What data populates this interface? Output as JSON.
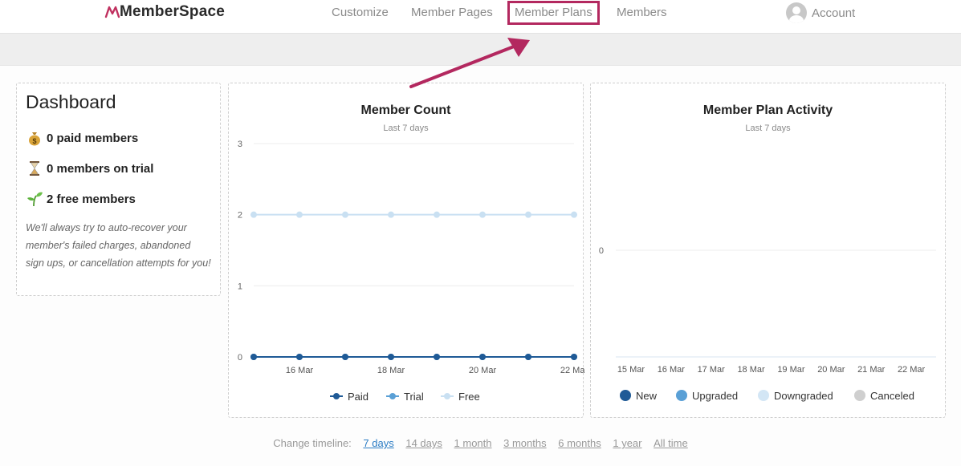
{
  "nav": {
    "logo": "MemberSpace",
    "links": [
      "Customize",
      "Member Pages",
      "Member Plans",
      "Members"
    ],
    "account": "Account"
  },
  "dashboard": {
    "title": "Dashboard",
    "paid": "0 paid members",
    "trial": "0 members on trial",
    "free": "2 free members",
    "note": "We'll always try to auto-recover your member's failed charges, abandoned sign ups, or cancellation attempts for you!"
  },
  "chart_data": [
    {
      "type": "line",
      "title": "Member Count",
      "subtitle": "Last 7 days",
      "x": [
        "15 Mar",
        "16 Mar",
        "17 Mar",
        "18 Mar",
        "19 Mar",
        "20 Mar",
        "21 Mar",
        "22 Mar"
      ],
      "tick_labels": [
        "16 Mar",
        "18 Mar",
        "20 Mar",
        "22 Mar"
      ],
      "yticks": [
        0,
        1,
        2,
        3
      ],
      "ylim": [
        0,
        3
      ],
      "grid": true,
      "legend": "bottom",
      "series": [
        {
          "name": "Paid",
          "values": [
            0,
            0,
            0,
            0,
            0,
            0,
            0,
            0
          ],
          "color": "#1f5a96"
        },
        {
          "name": "Trial",
          "values": [
            0,
            0,
            0,
            0,
            0,
            0,
            0,
            0
          ],
          "color": "#5aa0d6"
        },
        {
          "name": "Free",
          "values": [
            2,
            2,
            2,
            2,
            2,
            2,
            2,
            2
          ],
          "color": "#c9e0f2"
        }
      ]
    },
    {
      "type": "bar",
      "title": "Member Plan Activity",
      "subtitle": "Last 7 days",
      "categories": [
        "15 Mar",
        "16 Mar",
        "17 Mar",
        "18 Mar",
        "19 Mar",
        "20 Mar",
        "21 Mar",
        "22 Mar"
      ],
      "yticks": [
        0
      ],
      "grid": true,
      "legend": "bottom",
      "series": [
        {
          "name": "New",
          "values": [
            0,
            0,
            0,
            0,
            0,
            0,
            0,
            0
          ],
          "color": "#1f5a96"
        },
        {
          "name": "Upgraded",
          "values": [
            0,
            0,
            0,
            0,
            0,
            0,
            0,
            0
          ],
          "color": "#5aa0d6"
        },
        {
          "name": "Downgraded",
          "values": [
            0,
            0,
            0,
            0,
            0,
            0,
            0,
            0
          ],
          "color": "#d3e6f5"
        },
        {
          "name": "Canceled",
          "values": [
            0,
            0,
            0,
            0,
            0,
            0,
            0,
            0
          ],
          "color": "#cfcfcf"
        }
      ]
    }
  ],
  "timeline": {
    "label": "Change timeline:",
    "options": [
      "7 days",
      "14 days",
      "1 month",
      "3 months",
      "6 months",
      "1 year",
      "All time"
    ],
    "active": "7 days"
  },
  "colors": {
    "highlight": "#b3285f",
    "link_active": "#2b7cc4"
  }
}
